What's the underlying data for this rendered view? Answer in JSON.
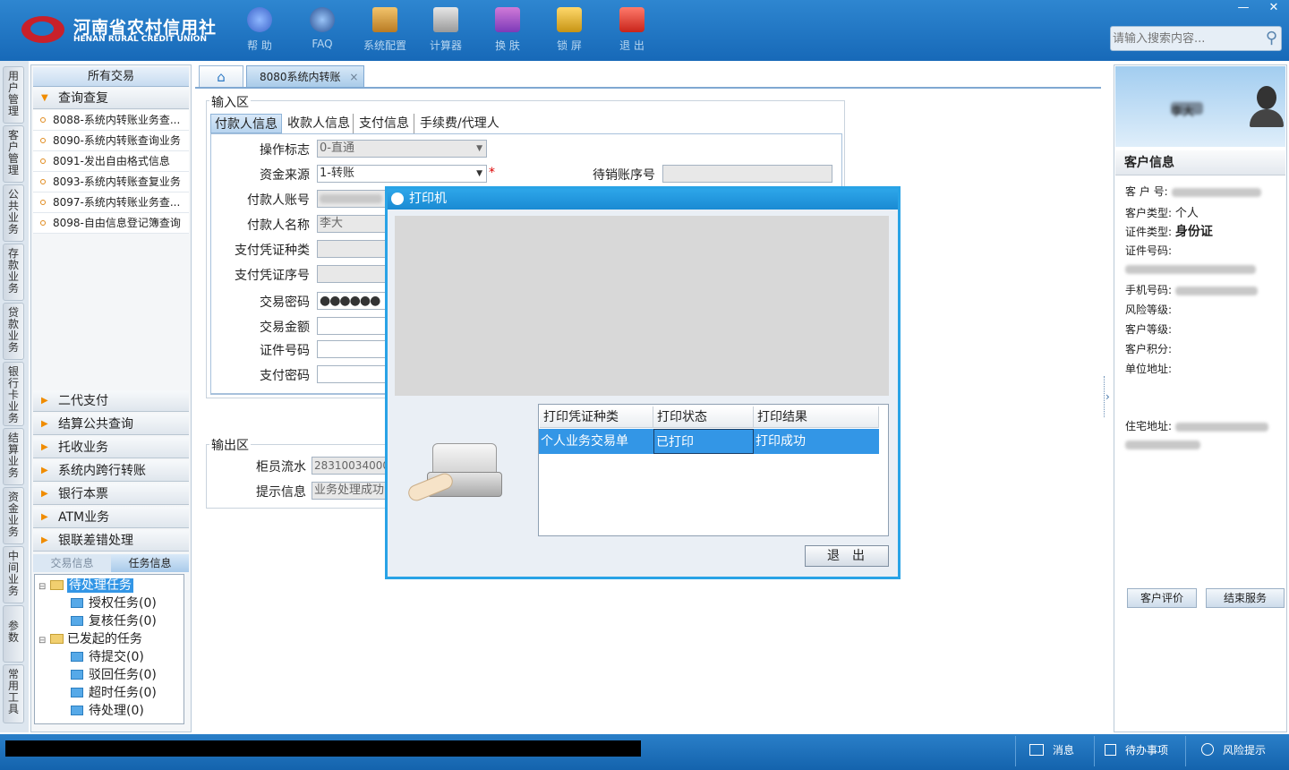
{
  "header": {
    "logo_cn": "河南省农村信用社",
    "logo_en": "HENAN RURAL CREDIT UNION",
    "toolbar": [
      {
        "label": "帮 助",
        "icon": "info-icon"
      },
      {
        "label": "FAQ",
        "icon": "question-icon"
      },
      {
        "label": "系统配置",
        "icon": "toolbox-icon"
      },
      {
        "label": "计算器",
        "icon": "calculator-icon"
      },
      {
        "label": "换 肤",
        "icon": "shirt-icon"
      },
      {
        "label": "锁 屏",
        "icon": "lock-icon"
      },
      {
        "label": "退 出",
        "icon": "power-icon"
      }
    ],
    "minimize": "—",
    "close": "✕",
    "search_placeholder": "请输入搜索内容..."
  },
  "vtabs": [
    "用户管理",
    "客户管理",
    "公共业务",
    "存款业务",
    "贷款业务",
    "银行卡业务",
    "结算业务",
    "资金业务",
    "中间业务",
    "参数",
    "常用工具"
  ],
  "nav": {
    "title": "所有交易",
    "open_group": "查询查复",
    "items": [
      "8088-系统内转账业务查...",
      "8090-系统内转账查询业务",
      "8091-发出自由格式信息",
      "8093-系统内转账查复业务",
      "8097-系统内转账业务查...",
      "8098-自由信息登记簿查询"
    ],
    "groups": [
      "二代支付",
      "结算公共查询",
      "托收业务",
      "系统内跨行转账",
      "银行本票",
      "ATM业务",
      "银联差错处理"
    ],
    "tab_trans": "交易信息",
    "tab_task": "任务信息",
    "tree": {
      "pending": "待处理任务",
      "auth": "授权任务(0)",
      "review": "复核任务(0)",
      "initiated": "已发起的任务",
      "to_submit": "待提交(0)",
      "rejected": "驳回任务(0)",
      "timeout": "超时任务(0)",
      "to_process": "待处理(0)"
    }
  },
  "tabs": {
    "active": "8080系统内转账",
    "close": "×"
  },
  "form": {
    "section_input": "输入区",
    "inner_tabs": [
      "付款人信息",
      "收款人信息",
      "支付信息",
      "手续费/代理人"
    ],
    "labels": [
      "操作标志",
      "资金来源",
      "付款人账号",
      "付款人名称",
      "支付凭证种类",
      "支付凭证序号",
      "交易密码",
      "交易金额",
      "证件号码",
      "支付密码"
    ],
    "op_flag": "0-直通",
    "fund_source": "1-转账",
    "required_mark": "*",
    "pending_label": "待销账序号",
    "payer_name": "李大",
    "password_mask": "●●●●●●",
    "section_output": "输出区",
    "teller_label": "柜员流水",
    "teller_value": "283100340000",
    "hint_label": "提示信息",
    "hint_value": "业务处理成功"
  },
  "dialog": {
    "title": "打印机",
    "col1": "打印凭证种类",
    "col2": "打印状态",
    "col3": "打印结果",
    "row_type": "个人业务交易单",
    "row_status": "已打印",
    "row_result": "打印成功",
    "exit": "退出"
  },
  "customer": {
    "name": "李大",
    "title": "客户信息",
    "no_label": "客 户 号:",
    "type_label": "客户类型:",
    "type_value": "个人",
    "cert_type_label": "证件类型:",
    "cert_type_value": "身份证",
    "cert_no_label": "证件号码:",
    "phone_label": "手机号码:",
    "risk_label": "风险等级:",
    "level_label": "客户等级:",
    "points_label": "客户积分:",
    "company_label": "单位地址:",
    "home_label": "住宅地址:",
    "eval_btn": "客户评价",
    "end_btn": "结束服务"
  },
  "status": {
    "msg": "消息",
    "todo": "待办事项",
    "risk": "风险提示"
  },
  "colors": {
    "header": "#1e78c6",
    "accent": "#29a3e6",
    "selected": "#3396e6",
    "brand_red": "#c8202a"
  }
}
